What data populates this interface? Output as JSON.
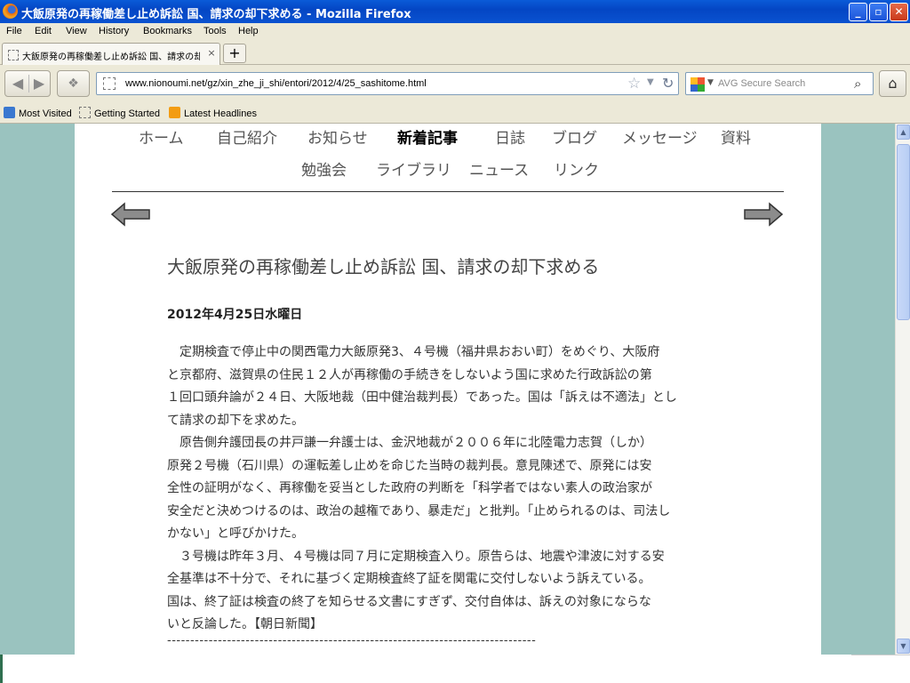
{
  "window": {
    "title": "大飯原発の再稼働差し止め訴訟  国、請求の却下求める - Mozilla Firefox"
  },
  "menu": [
    "File",
    "Edit",
    "View",
    "History",
    "Bookmarks",
    "Tools",
    "Help"
  ],
  "tab": {
    "label": "大飯原発の再稼働差し止め訴訟  国、請求の却下求める",
    "close": "×",
    "new": "+"
  },
  "nav": {
    "url": "www.nionoumi.net/gz/xin_zhe_ji_shi/entori/2012/4/25_sashitome.html",
    "search_placeholder": "AVG Secure Search",
    "icons": [
      "back-icon",
      "forward-icon",
      "speed-dial-icon",
      "bookmark-star-icon",
      "reload-icon",
      "search-icon",
      "home-icon"
    ]
  },
  "bookmarks": [
    "Most Visited",
    "Getting Started",
    "Latest Headlines"
  ],
  "site": {
    "nav_row1": [
      "ホーム",
      "自己紹介",
      "お知らせ",
      "新着記事",
      "日誌",
      "ブログ",
      "メッセージ",
      "資料"
    ],
    "nav_row2": [
      "勉強会",
      "ライブラリ",
      "ニュース",
      "リンク"
    ],
    "active_nav": "新着記事"
  },
  "article": {
    "title": "大飯原発の再稼働差し止め訴訟  国、請求の却下求める",
    "date": "2012年4月25日水曜日",
    "lines": [
      "　定期検査で停止中の関西電力大飯原発3、４号機（福井県おおい町）をめぐり、大阪府",
      "と京都府、滋賀県の住民１２人が再稼働の手続きをしないよう国に求めた行政訴訟の第",
      "１回口頭弁論が２４日、大阪地裁（田中健治裁判長）であった。国は「訴えは不適法」とし",
      "て請求の却下を求めた。",
      "　原告側弁護団長の井戸謙一弁護士は、金沢地裁が２００６年に北陸電力志賀（しか）",
      "原発２号機（石川県）の運転差し止めを命じた当時の裁判長。意見陳述で、原発には安",
      "全性の証明がなく、再稼働を妥当とした政府の判断を「科学者ではない素人の政治家が",
      "安全だと決めつけるのは、政治の越権であり、暴走だ」と批判。「止められるのは、司法し",
      "かない」と呼びかけた。",
      "　３号機は昨年３月、４号機は同７月に定期検査入り。原告らは、地震や津波に対する安",
      "全基準は不十分で、それに基づく定期検査終了証を関電に交付しないよう訴えている。",
      "国は、終了証は検査の終了を知らせる文書にすぎず、交付自体は、訴えの対象にならな",
      "いと反論した。【朝日新聞】"
    ],
    "divider": "--------------------------------------------------------------------------------"
  },
  "colors": {
    "page_background": "#9ac3bf",
    "titlebar": "#0a52d0",
    "chrome": "#ece9d8"
  }
}
